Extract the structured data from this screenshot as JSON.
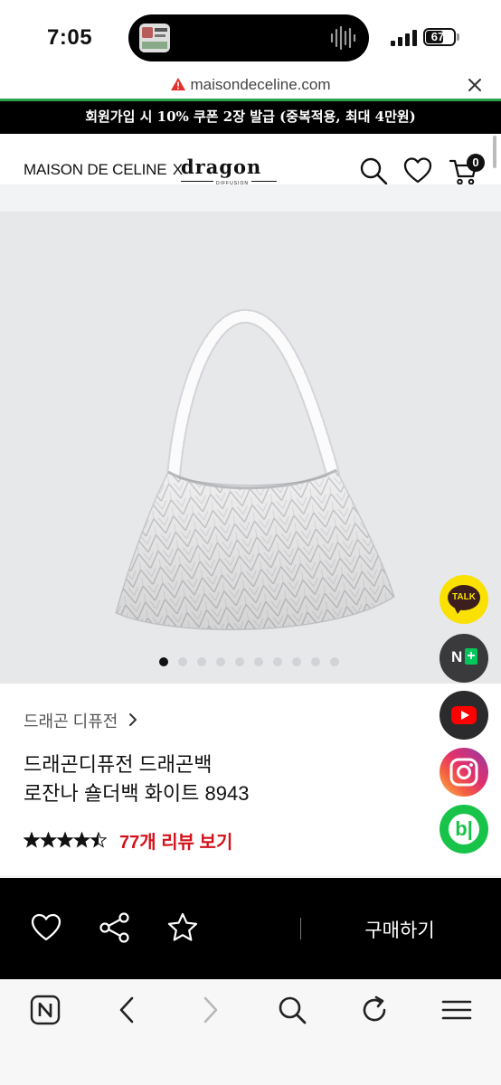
{
  "status_bar": {
    "time": "7:05",
    "battery": "67",
    "battery_level": 0.67,
    "island_icon": "audio-waveform-icon"
  },
  "browser": {
    "url": "maisondeceline.com",
    "warning_icon": "warning-triangle-icon",
    "close_icon": "close-icon",
    "progress_color": "#2ba34a"
  },
  "promo": {
    "text": "회원가입 시 10% 쿠폰 2장 발급 (중복적용, 최대 4만원)"
  },
  "header": {
    "brand": "MAISON DE CELINE",
    "brand_x": "X",
    "partner_logo": "dragon",
    "partner_sub": "DIFFUSION",
    "cart_count": "0",
    "icons": [
      "search-icon",
      "heart-icon",
      "cart-icon"
    ]
  },
  "gallery": {
    "image": "white woven leather shoulder bag",
    "total_images": 10,
    "active_index": 0
  },
  "floating": {
    "talk_label": "TALK",
    "naver_label": "N",
    "naver_plus": "+",
    "blog_label": "b|",
    "icons": [
      "kakaotalk-icon",
      "naver-plus-icon",
      "youtube-icon",
      "instagram-icon",
      "blog-icon"
    ]
  },
  "product": {
    "category": "드래곤 디퓨전",
    "title_line1": "드래곤디퓨전 드래곤백",
    "title_line2": "로잔나 숄더백 화이트 8943",
    "rating": 4.5,
    "max_rating": 5,
    "review_link": "77개 리뷰 보기",
    "accent_color": "#d3121b"
  },
  "action_bar": {
    "buy_label": "구매하기",
    "icons": [
      "wishlist-heart-icon",
      "share-icon",
      "favorite-star-icon"
    ]
  },
  "toolbar": {
    "icons": [
      "naver-home-icon",
      "back-icon",
      "forward-icon",
      "search-icon",
      "refresh-icon",
      "menu-icon"
    ]
  }
}
